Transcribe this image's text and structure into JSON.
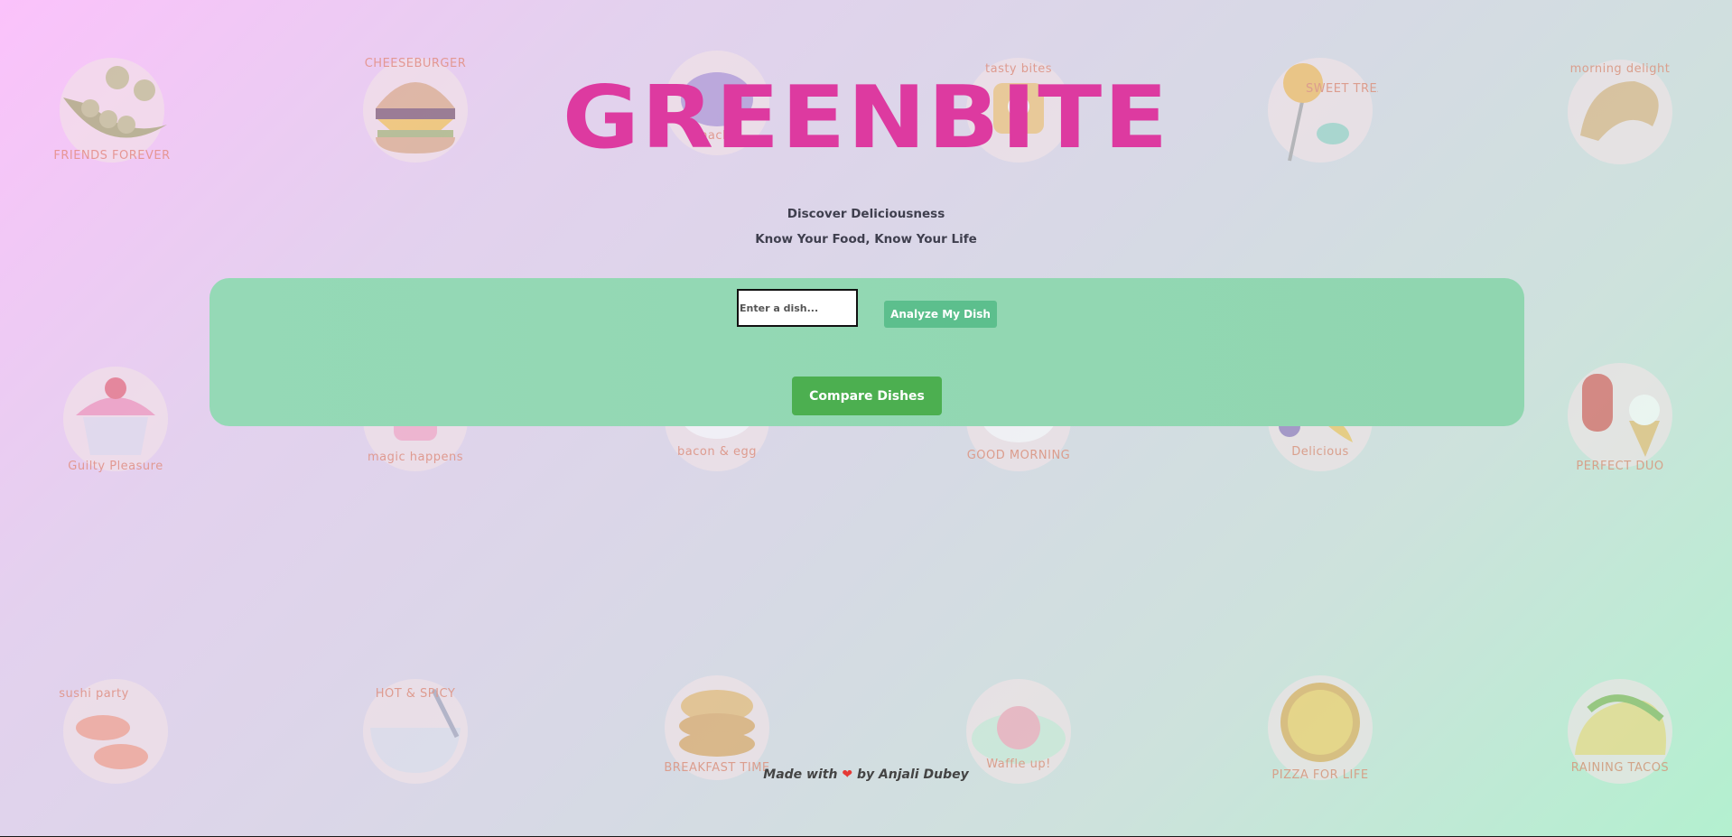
{
  "header": {
    "title": "GREENBITE",
    "tagline_1": "Discover Deliciousness",
    "tagline_2": "Know Your Food, Know Your Life"
  },
  "analyzer": {
    "dish_placeholder": "Enter a dish...",
    "analyze_label": "Analyze My Dish",
    "compare_label": "Compare Dishes"
  },
  "footer": {
    "prefix": "Made with",
    "heart": "❤",
    "suffix": "by Anjali Dubey"
  },
  "stickers": [
    {
      "icon": "peas-icon",
      "caption": "FRIENDS FOREVER"
    },
    {
      "icon": "cheeseburger-icon",
      "caption": "CHEESEBURGER"
    },
    {
      "icon": "snack-icon",
      "caption": "snack"
    },
    {
      "icon": "tasty-bites-icon",
      "caption": "tasty bites"
    },
    {
      "icon": "lollipop-candy-icon",
      "caption": "SWEET TREAT"
    },
    {
      "icon": "croissant-icon",
      "caption": "morning delight"
    },
    {
      "icon": "cupcake-icon",
      "caption": "Guilty Pleasure"
    },
    {
      "icon": "magic-happens-icon",
      "caption": "magic happens"
    },
    {
      "icon": "bacon-eggs-icon",
      "caption": "bacon & egg"
    },
    {
      "icon": "fried-egg-icon",
      "caption": "GOOD MORNING"
    },
    {
      "icon": "fruit-icon",
      "caption": "Delicious"
    },
    {
      "icon": "ice-cream-icon",
      "caption": "PERFECT DUO"
    },
    {
      "icon": "sushi-icon",
      "caption": "sushi party"
    },
    {
      "icon": "ramen-icon",
      "caption": "HOT & SPICY"
    },
    {
      "icon": "pancakes-icon",
      "caption": "BREAKFAST TIME"
    },
    {
      "icon": "waffle-icon",
      "caption": "Waffle up!"
    },
    {
      "icon": "pizza-icon",
      "caption": "PIZZA FOR LIFE"
    },
    {
      "icon": "taco-icon",
      "caption": "RAINING TACOS"
    }
  ],
  "colors": {
    "title": "#dd3aa0",
    "panel": "#95d9b6",
    "analyze_button": "#5cbf8d",
    "compare_button": "#4caf50"
  }
}
